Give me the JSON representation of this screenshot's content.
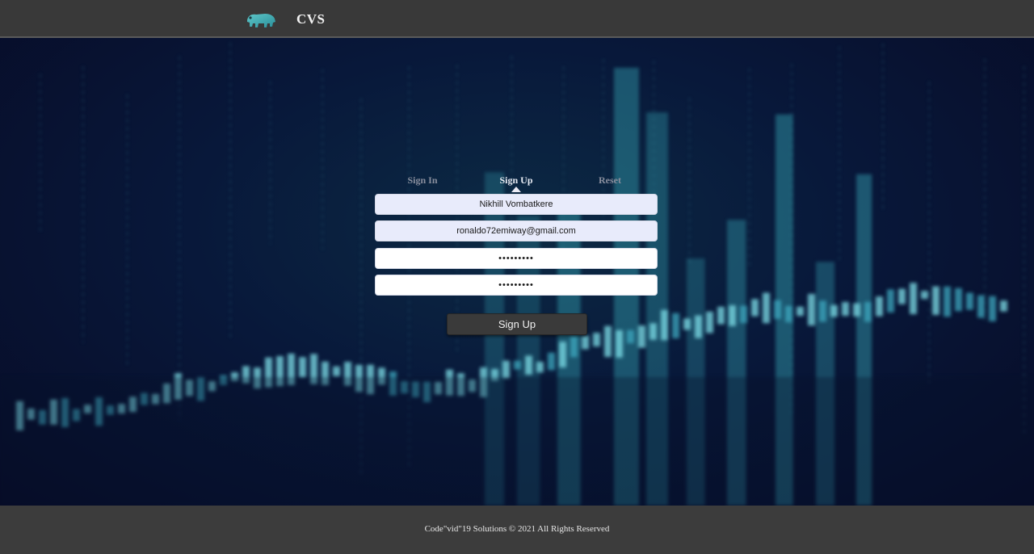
{
  "header": {
    "brand": "CVS",
    "logo_icon": "bear-logo-icon"
  },
  "auth": {
    "tabs": [
      {
        "label": "Sign In",
        "active": false
      },
      {
        "label": "Sign Up",
        "active": true
      },
      {
        "label": "Reset",
        "active": false
      }
    ],
    "fields": {
      "name_value": "Nikhill Vombatkere",
      "email_value": "ronaldo72emiway@gmail.com",
      "password_value": "•••••••••",
      "confirm_password_value": "•••••••••"
    },
    "submit_label": "Sign Up"
  },
  "footer": {
    "text": "Code\"vid\"19 Solutions © 2021 All Rights Reserved"
  },
  "colors": {
    "header_bg": "#393939",
    "hero_accent": "#3fc3cf",
    "hero_bg": "#08183a",
    "filled_field_bg": "#e8ebfb",
    "button_bg": "#3a3a3a"
  }
}
